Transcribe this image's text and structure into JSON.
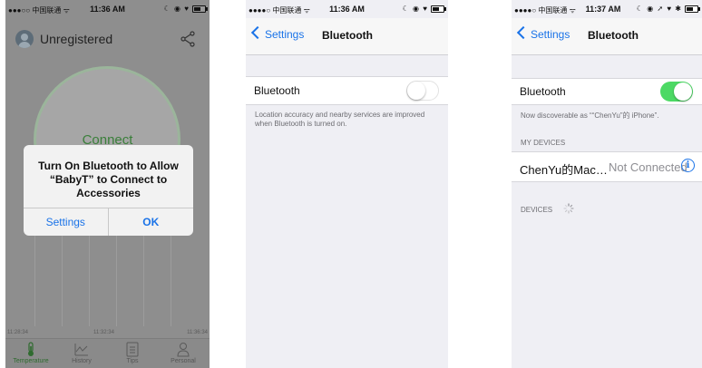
{
  "phones": [
    {
      "status": {
        "carrier": "●●●○○ 中国联通 ᯤ",
        "time": "11:36 AM",
        "icons": "☾ ◉ ♥"
      },
      "app": {
        "title": "Unregistered",
        "connect_label": "Connect",
        "chart_ticks": [
          "11:28:34",
          "11:32:34",
          "11:36:34"
        ],
        "tabs": [
          {
            "label": "Temperature",
            "icon": "thermometer-icon"
          },
          {
            "label": "History",
            "icon": "history-chart-icon"
          },
          {
            "label": "Tips",
            "icon": "tips-list-icon"
          },
          {
            "label": "Personal",
            "icon": "person-icon"
          }
        ],
        "alert": {
          "message": "Turn On Bluetooth to Allow “BabyT” to Connect to Accessories",
          "buttons": [
            "Settings",
            "OK"
          ]
        }
      }
    },
    {
      "status": {
        "carrier": "●●●●○ 中国联通 ᯤ",
        "time": "11:36 AM",
        "icons": "☾ ◉ ♥"
      },
      "nav": {
        "back": "Settings",
        "title": "Bluetooth"
      },
      "bluetooth_label": "Bluetooth",
      "bluetooth_on": false,
      "footnote": "Location accuracy and nearby services are improved when Bluetooth is turned on."
    },
    {
      "status": {
        "carrier": "●●●●○ 中国联通 ᯤ",
        "time": "11:37 AM",
        "icons": "☾ ◉ ➚ ♥ ✱"
      },
      "nav": {
        "back": "Settings",
        "title": "Bluetooth"
      },
      "bluetooth_label": "Bluetooth",
      "bluetooth_on": true,
      "discoverable": "Now discoverable as ““ChenYu”的 iPhone”.",
      "my_devices_header": "MY DEVICES",
      "device": {
        "name": "ChenYu的Mac…",
        "status": "Not Connected"
      },
      "devices_header": "DEVICES"
    }
  ],
  "colors": {
    "ios_blue": "#1a73e8",
    "switch_on": "#4cd964",
    "connect_green": "#3a7f3a"
  }
}
